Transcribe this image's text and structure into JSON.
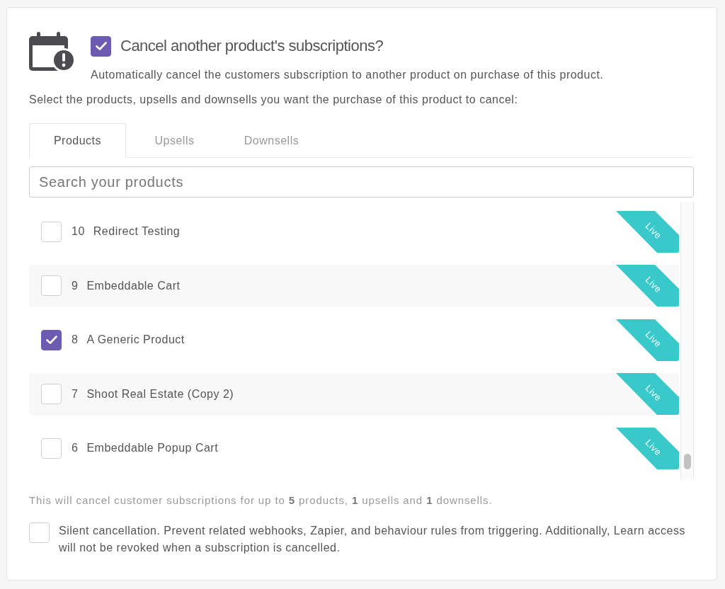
{
  "header": {
    "title": "Cancel another product's subscriptions?",
    "checked": true,
    "description": "Automatically cancel the customers subscription to another product on purchase of this product."
  },
  "instruction": "Select the products, upsells and downsells you want the purchase of this product to cancel:",
  "tabs": [
    {
      "label": "Products",
      "selected": true
    },
    {
      "label": "Upsells",
      "selected": false
    },
    {
      "label": "Downsells",
      "selected": false
    }
  ],
  "search": {
    "placeholder": "Search your products"
  },
  "products": [
    {
      "number": "10",
      "name": "Redirect Testing",
      "checked": false,
      "status": "Live"
    },
    {
      "number": "9",
      "name": "Embeddable Cart",
      "checked": false,
      "status": "Live"
    },
    {
      "number": "8",
      "name": "A Generic Product",
      "checked": true,
      "status": "Live"
    },
    {
      "number": "7",
      "name": "Shoot Real Estate (Copy 2)",
      "checked": false,
      "status": "Live"
    },
    {
      "number": "6",
      "name": "Embeddable Popup Cart",
      "checked": false,
      "status": "Live"
    }
  ],
  "summary": "This will cancel customer subscriptions for up to **5** products, **1** upsells and **1** downsells.",
  "silent_option": {
    "label": "Silent cancellation. Prevent related webhooks, Zapier, and behaviour rules from triggering. Additionally, Learn access will not be revoked when a subscription is cancelled.",
    "checked": false
  }
}
